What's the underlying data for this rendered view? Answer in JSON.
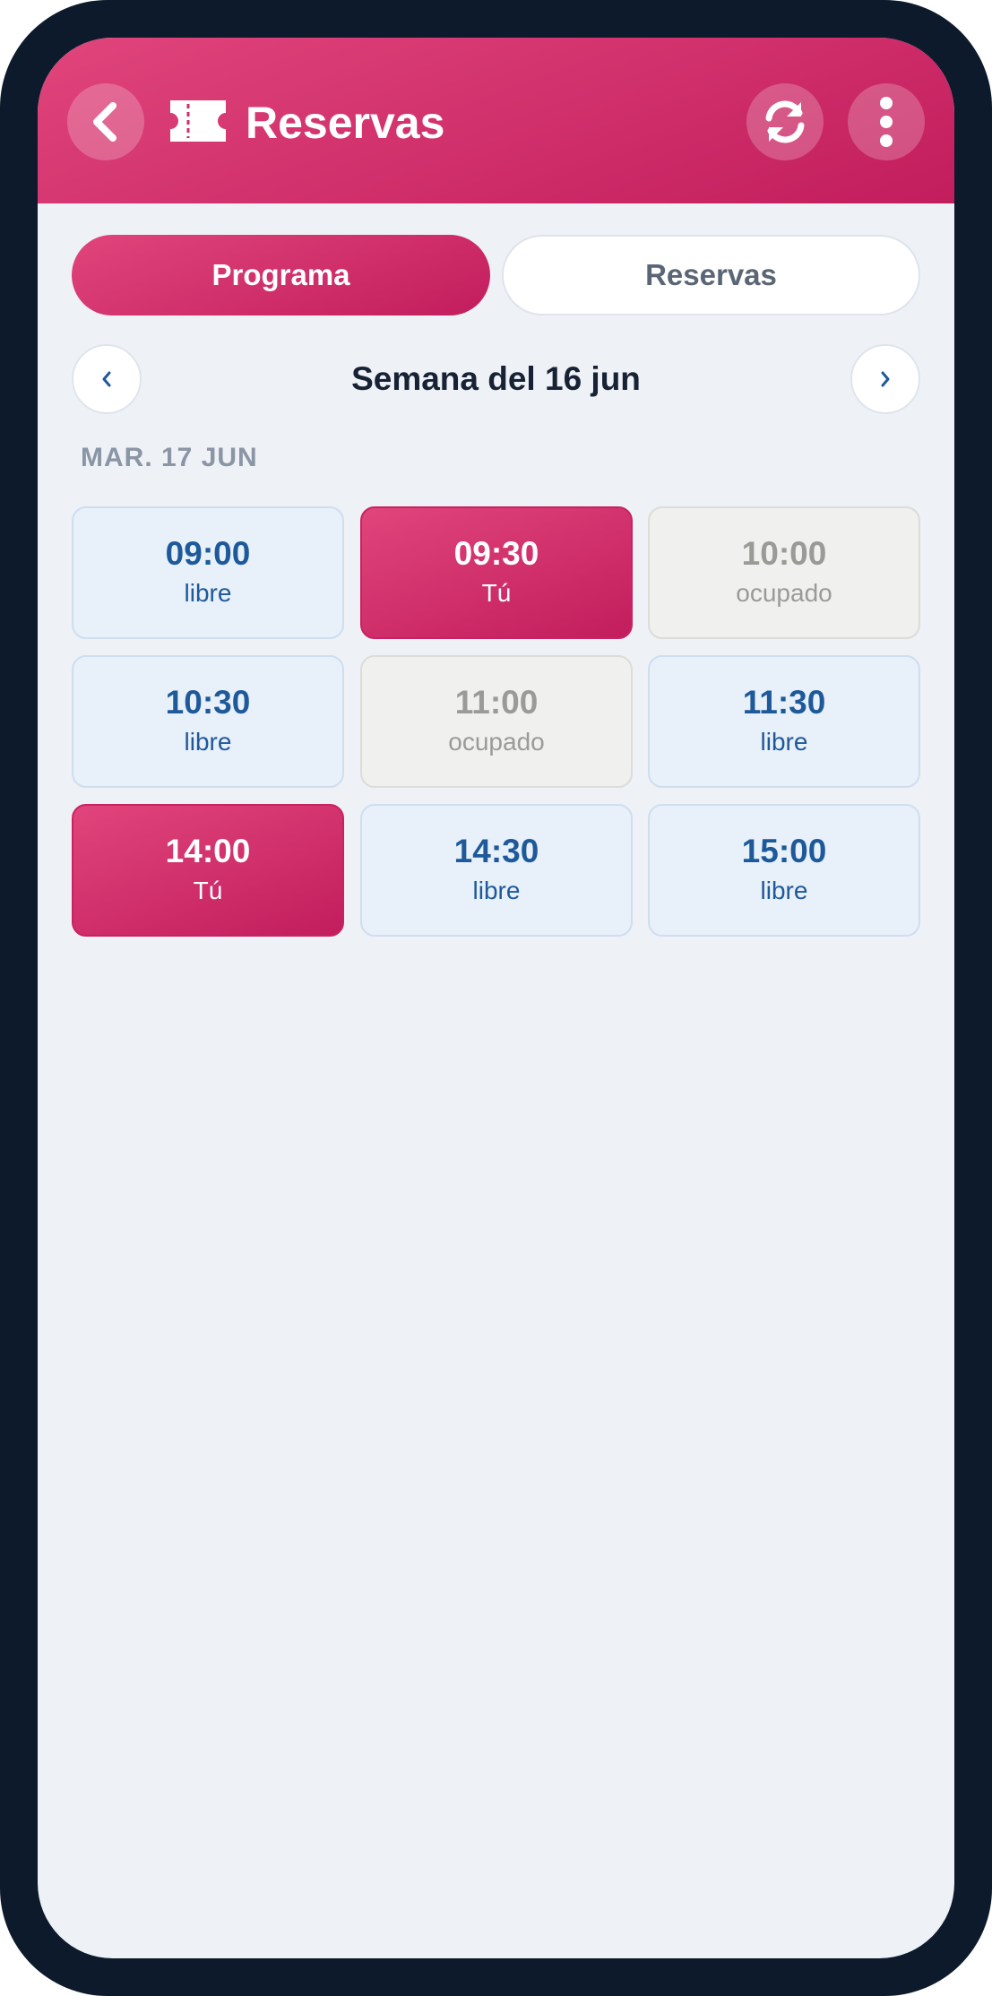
{
  "header": {
    "title": "Reservas",
    "back_icon": "chevron-left-icon",
    "title_icon": "ticket-icon",
    "refresh_icon": "refresh-icon",
    "menu_icon": "more-vertical-icon",
    "gradient_start": "#e0457b",
    "gradient_end": "#c21d5d"
  },
  "tabs": [
    {
      "label": "Programa",
      "active": true
    },
    {
      "label": "Reservas",
      "active": false
    }
  ],
  "week": {
    "title": "Semana del 16 jun",
    "prev_icon": "chevron-left-icon",
    "next_icon": "chevron-right-icon"
  },
  "day": {
    "label": "MAR. 17 JUN",
    "slots": [
      {
        "time": "09:00",
        "status": "libre",
        "state": "free"
      },
      {
        "time": "09:30",
        "status": "Tú",
        "state": "mine"
      },
      {
        "time": "10:00",
        "status": "ocupado",
        "state": "busy"
      },
      {
        "time": "10:30",
        "status": "libre",
        "state": "free"
      },
      {
        "time": "11:00",
        "status": "ocupado",
        "state": "busy"
      },
      {
        "time": "11:30",
        "status": "libre",
        "state": "free"
      },
      {
        "time": "14:00",
        "status": "Tú",
        "state": "mine"
      },
      {
        "time": "14:30",
        "status": "libre",
        "state": "free"
      },
      {
        "time": "15:00",
        "status": "libre",
        "state": "free"
      }
    ]
  },
  "colors": {
    "accent": "#d02c68",
    "free_text": "#1e5a9a",
    "busy_text": "#9a9a96",
    "background": "#eef1f6",
    "frame": "#0c1a2b"
  }
}
